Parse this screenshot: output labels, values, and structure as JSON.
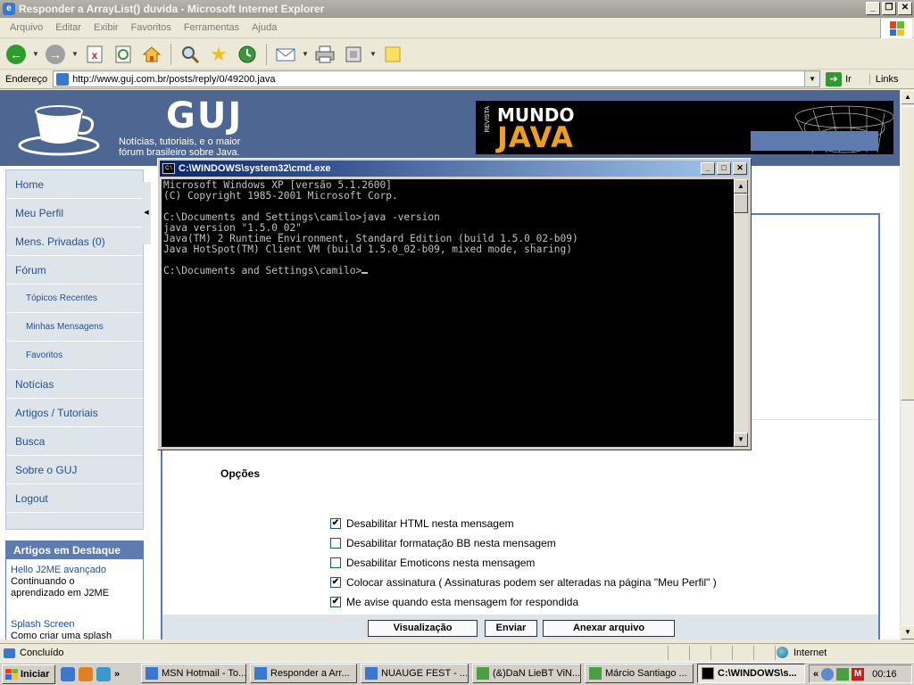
{
  "window": {
    "title": "Responder a ArrayList() duvida - Microsoft Internet Explorer",
    "minimize_glyph": "_",
    "maximize_glyph": "❐",
    "close_glyph": "✕"
  },
  "menu": [
    "Arquivo",
    "Editar",
    "Exibir",
    "Favoritos",
    "Ferramentas",
    "Ajuda"
  ],
  "address": {
    "label": "Endereço",
    "url": "http://www.guj.com.br/posts/reply/0/49200.java",
    "go_label": "Ir",
    "links_label": "Links"
  },
  "site": {
    "name": "GUJ",
    "tagline_1": "Notícias, tutoriais, e o maior",
    "tagline_2": "fórum brasileiro sobre Java.",
    "banner_revista": "REVISTA",
    "banner_mundo": "MUNDO",
    "banner_java": "JAVA"
  },
  "sidebar": {
    "items": [
      {
        "label": "Home",
        "sub": false
      },
      {
        "label": "Meu Perfil",
        "sub": false
      },
      {
        "label": "Mens. Privadas (0)",
        "sub": false
      },
      {
        "label": "Fórum",
        "sub": false
      },
      {
        "label": "Tópicos Recentes",
        "sub": true
      },
      {
        "label": "Minhas Mensagens",
        "sub": true
      },
      {
        "label": "Favoritos",
        "sub": true
      },
      {
        "label": "Notícias",
        "sub": false
      },
      {
        "label": "Artigos / Tutoriais",
        "sub": false
      },
      {
        "label": "Busca",
        "sub": false
      },
      {
        "label": "Sobre o GUJ",
        "sub": false
      },
      {
        "label": "Logout",
        "sub": false
      }
    ]
  },
  "destaque": {
    "title": "Artigos em Destaque",
    "item1_link": "Hello J2ME avançado",
    "item1_desc_1": "Continuando o",
    "item1_desc_2": "aprendizado em J2ME",
    "item2_link": "Splash Screen",
    "item2_desc": "Como criar uma splash"
  },
  "options": {
    "label": "Opções",
    "items": [
      {
        "label": "Desabilitar HTML nesta mensagem",
        "checked": true
      },
      {
        "label": "Desabilitar formatação BB nesta mensagem",
        "checked": false
      },
      {
        "label": "Desabilitar Emoticons nesta mensagem",
        "checked": false
      },
      {
        "label": "Colocar assinatura ( Assinaturas podem ser alteradas na página \"Meu Perfil\" )",
        "checked": true
      },
      {
        "label": "Me avise quando esta mensagem for respondida",
        "checked": true
      }
    ],
    "check_glyph": "✔"
  },
  "buttons": {
    "preview": "Visualização",
    "send": "Enviar",
    "attach": "Anexar arquivo"
  },
  "cmd": {
    "title": "C:\\WINDOWS\\system32\\cmd.exe",
    "icon_text": "C:\\",
    "lines": [
      "Microsoft Windows XP [versão 5.1.2600]",
      "(C) Copyright 1985-2001 Microsoft Corp.",
      "",
      "C:\\Documents and Settings\\camilo>java -version",
      "java version \"1.5.0_02\"",
      "Java(TM) 2 Runtime Environment, Standard Edition (build 1.5.0_02-b09)",
      "Java HotSpot(TM) Client VM (build 1.5.0_02-b09, mixed mode, sharing)",
      "",
      "C:\\Documents and Settings\\camilo>"
    ]
  },
  "status": {
    "text": "Concluído",
    "zone": "Internet"
  },
  "taskbar": {
    "start": "Iniciar",
    "more_glyph": "»",
    "tray_more_glyph": "«",
    "tasks": [
      {
        "label": "MSN Hotmail - To...",
        "active": false
      },
      {
        "label": "Responder a Arr...",
        "active": false
      },
      {
        "label": "NUAUGE FEST - ...",
        "active": false
      },
      {
        "label": "(&)DaN LieBT ViN...",
        "active": false
      },
      {
        "label": "Márcio Santiago ...",
        "active": false
      },
      {
        "label": "C:\\WINDOWS\\s...",
        "active": true
      }
    ],
    "time": "00:16"
  },
  "colors": {
    "header_blue": "#4d6792",
    "sidebar_bg": "#dde4ea",
    "link_blue": "#27508a",
    "cmd_bg": "#000000",
    "cmd_fg": "#c0c0c0"
  }
}
